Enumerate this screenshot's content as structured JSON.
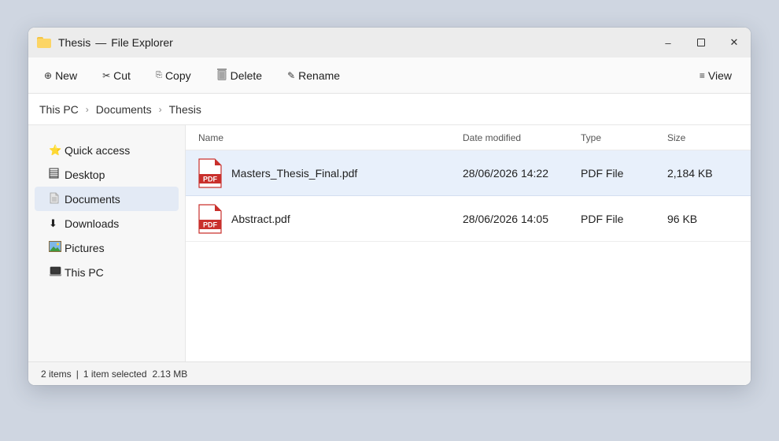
{
  "window": {
    "folder": "Thesis",
    "app": "File Explorer",
    "separator": "—"
  },
  "controls": {
    "minimize": "–",
    "close": "✕"
  },
  "toolbar": {
    "new_label": "New",
    "cut_label": "Cut",
    "copy_label": "Copy",
    "delete_label": "Delete",
    "rename_label": "Rename",
    "view_label": "View"
  },
  "breadcrumb": [
    "This PC",
    "Documents",
    "Thesis"
  ],
  "sidebar": {
    "items": [
      {
        "label": "Quick access",
        "icon": "star-icon"
      },
      {
        "label": "Desktop",
        "icon": "desktop-icon"
      },
      {
        "label": "Documents",
        "icon": "documents-icon"
      },
      {
        "label": "Downloads",
        "icon": "download-arrow-icon"
      },
      {
        "label": "Pictures",
        "icon": "pictures-icon"
      },
      {
        "label": "This PC",
        "icon": "laptop-icon"
      }
    ],
    "active": "Documents"
  },
  "columns": {
    "name": "Name",
    "date": "Date modified",
    "type": "Type",
    "size": "Size"
  },
  "files": [
    {
      "name": "Masters_Thesis_Final.pdf",
      "date": "28/06/2026 14:22",
      "type": "PDF File",
      "size": "2,184 KB",
      "selected": true
    },
    {
      "name": "Abstract.pdf",
      "date": "28/06/2026 14:05",
      "type": "PDF File",
      "size": "96 KB",
      "selected": false
    }
  ],
  "pdf_badge": "PDF",
  "status": {
    "items": "2 items",
    "divider": "|",
    "selected": "1 item selected",
    "size": "2.13 MB"
  },
  "colors": {
    "accent_selected": "#e8f0fb",
    "pdf_red": "#c9302c",
    "folder_yellow": "#fcd565"
  }
}
